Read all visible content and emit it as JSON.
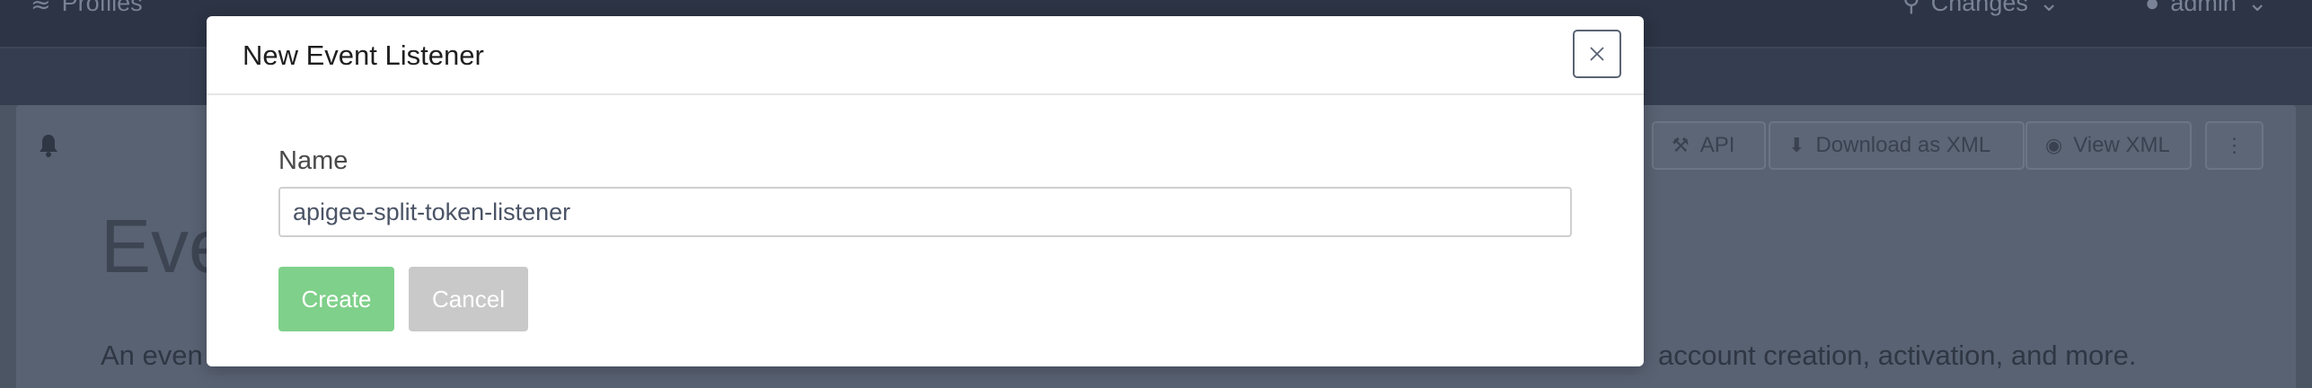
{
  "background": {
    "nav": {
      "profiles_label": "Profiles",
      "changes_label": "Changes",
      "admin_label": "admin"
    },
    "toolbar": {
      "api_label": "API",
      "download_label": "Download as XML",
      "view_label": "View XML",
      "more_icon": "⋮"
    },
    "page": {
      "heading": "Eve",
      "description_left": "An even",
      "description_right": "account creation, activation, and more."
    }
  },
  "modal": {
    "title": "New Event Listener",
    "close_icon": "×",
    "name_label": "Name",
    "name_value": "apigee-split-token-listener",
    "create_label": "Create",
    "cancel_label": "Cancel"
  },
  "colors": {
    "create_button": "#7fd08a",
    "cancel_button": "#c9c9c9",
    "overlay_topbar": "#2c3445"
  }
}
